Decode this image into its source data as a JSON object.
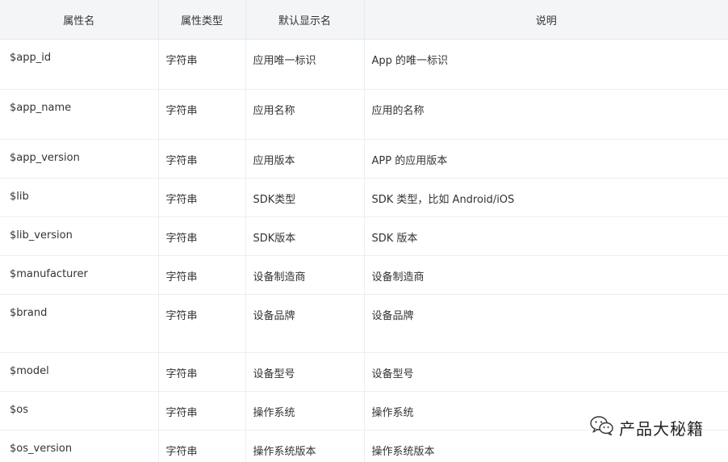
{
  "table": {
    "headers": [
      "属性名",
      "属性类型",
      "默认显示名",
      "说明"
    ],
    "rows": [
      [
        "$app_id",
        "字符串",
        "应用唯一标识",
        "App 的唯一标识"
      ],
      [
        "$app_name",
        "字符串",
        "应用名称",
        "应用的名称"
      ],
      [
        "$app_version",
        "字符串",
        "应用版本",
        "APP 的应用版本"
      ],
      [
        "$lib",
        "字符串",
        "SDK类型",
        "SDK 类型，比如 Android/iOS"
      ],
      [
        "$lib_version",
        "字符串",
        "SDK版本",
        "SDK 版本"
      ],
      [
        "$manufacturer",
        "字符串",
        "设备制造商",
        "设备制造商"
      ],
      [
        "$brand",
        "字符串",
        "设备品牌",
        "设备品牌"
      ],
      [
        "$model",
        "字符串",
        "设备型号",
        "设备型号"
      ],
      [
        "$os",
        "字符串",
        "操作系统",
        "操作系统"
      ],
      [
        "$os_version",
        "字符串",
        "操作系统版本",
        "操作系统版本"
      ]
    ]
  },
  "watermark": {
    "text": "产品大秘籍",
    "icon": "wechat-icon"
  }
}
